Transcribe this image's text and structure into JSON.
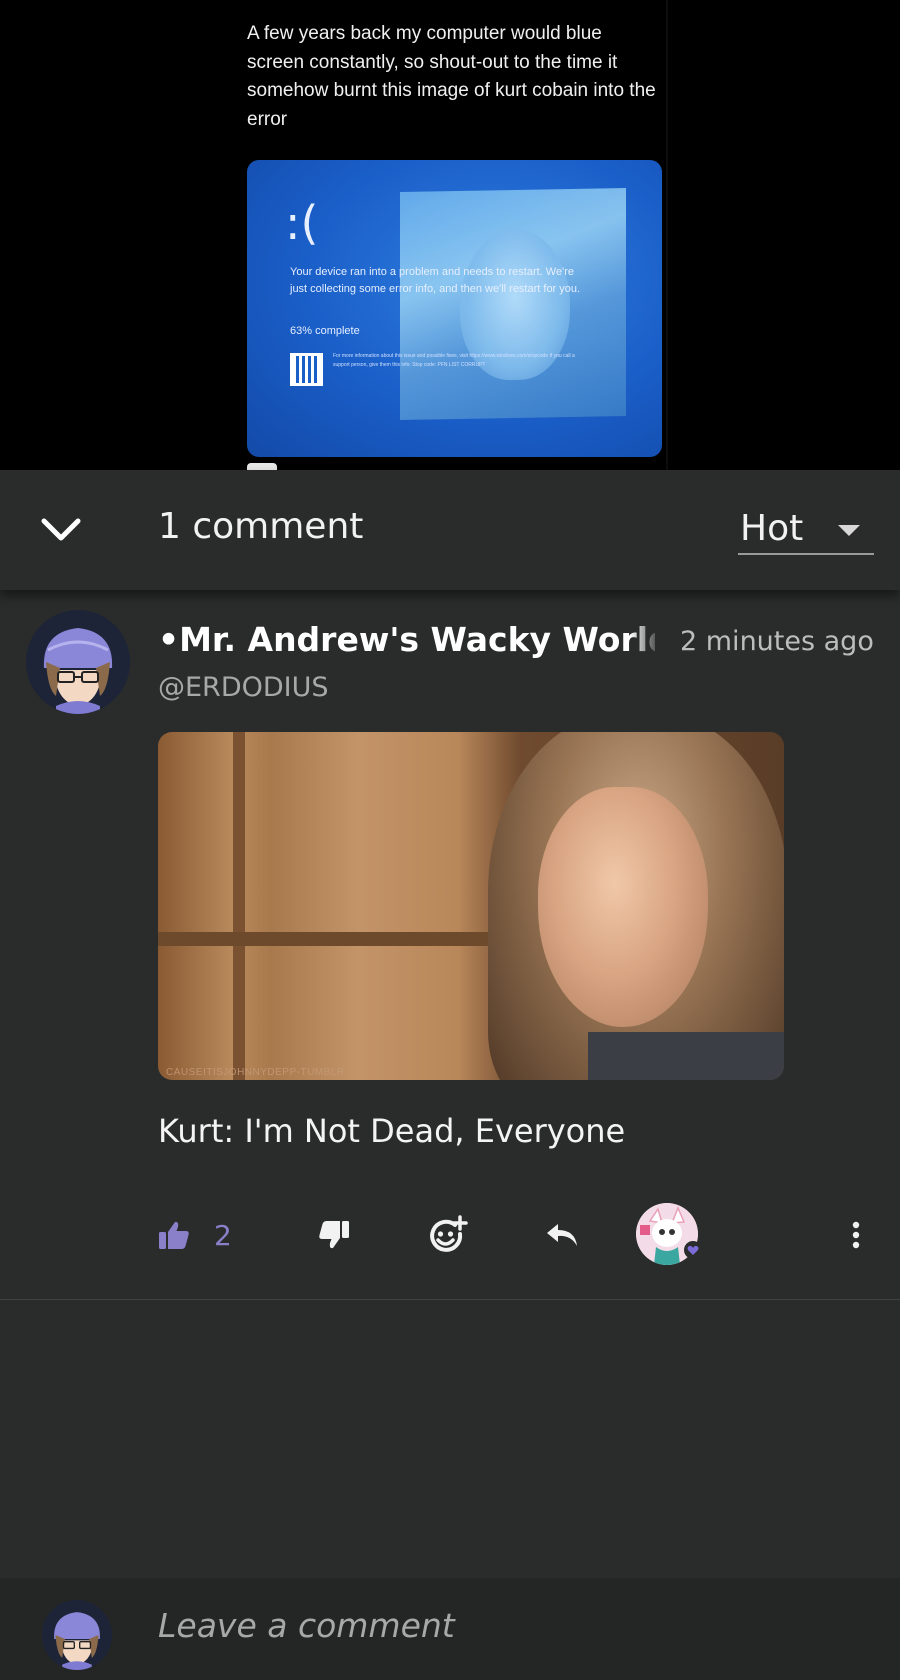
{
  "post": {
    "text": "A few years back my computer would blue screen constantly, so shout-out to the time it somehow burnt this image of kurt cobain into the error",
    "bsod": {
      "sad_face": ":(",
      "message": "Your device ran into a problem and needs to restart. We're just collecting some error info, and then we'll restart for you.",
      "progress": "63% complete",
      "fine_print": "For more information about this issue and possible fixes, visit https://www.windows.com/stopcode  If you call a support person, give them this info:  Stop code: PFN LIST CORRUPT"
    }
  },
  "comments_header": {
    "count_label": "1 comment",
    "sort_label": "Hot"
  },
  "comment": {
    "author": "•Mr. Andrew's Wacky World",
    "timestamp": "2 minutes ago",
    "handle": "@ERDODIUS",
    "image_watermark": "CAUSEITISJOHNNYDEPP-TUMBLR",
    "text": "Kurt: I'm Not Dead, Everyone",
    "like_count": "2"
  },
  "composer": {
    "placeholder": "Leave a comment"
  },
  "icons": {
    "collapse": "chevron-down-icon",
    "sort": "caret-down-icon",
    "like": "thumbs-up-icon",
    "dislike": "thumbs-down-icon",
    "react": "add-emoji-icon",
    "reply": "reply-icon",
    "more": "more-vertical-icon",
    "heart": "heart-icon"
  },
  "colors": {
    "background": "#2a2c2b",
    "post_background": "#000000",
    "like_accent": "#8a7fc9",
    "heart_accent": "#7b6bd6"
  }
}
